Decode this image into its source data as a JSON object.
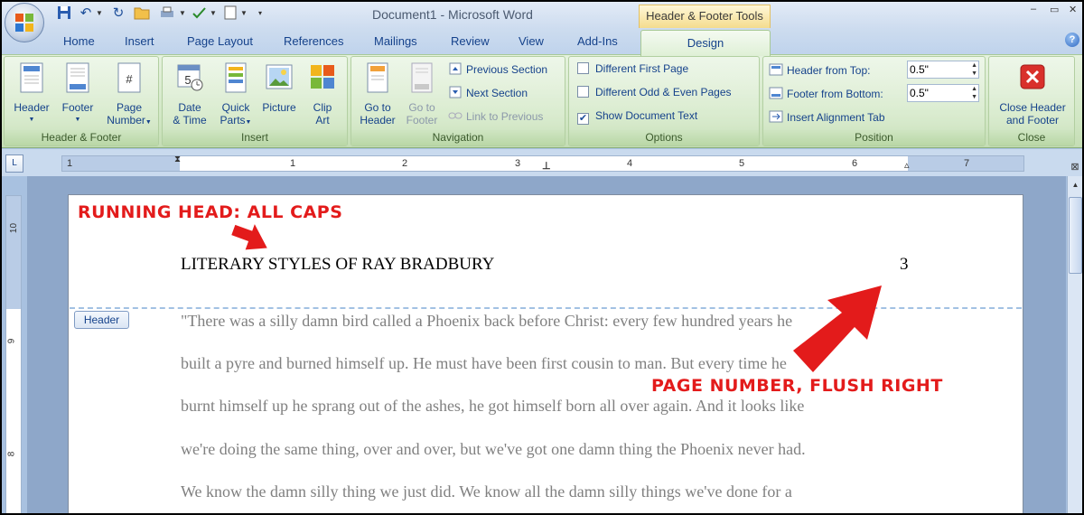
{
  "window": {
    "doc_title": "Document1 - Microsoft Word",
    "contextual_tab_title": "Header & Footer Tools",
    "controls": {
      "minimize": "–",
      "restore": "▭",
      "close": "✕"
    }
  },
  "quick_access": [
    "save-icon",
    "undo-icon",
    "redo-icon",
    "open-icon",
    "print-icon",
    "spelling-icon",
    "new-icon",
    "customize-icon"
  ],
  "tabs": [
    {
      "label": "Home"
    },
    {
      "label": "Insert"
    },
    {
      "label": "Page Layout"
    },
    {
      "label": "References"
    },
    {
      "label": "Mailings"
    },
    {
      "label": "Review"
    },
    {
      "label": "View"
    },
    {
      "label": "Add-Ins"
    },
    {
      "label": "Design",
      "active": true
    }
  ],
  "ribbon": {
    "header_footer": {
      "caption": "Header & Footer",
      "header": "Header",
      "footer": "Footer",
      "page_number_1": "Page",
      "page_number_2": "Number"
    },
    "insert": {
      "caption": "Insert",
      "date_1": "Date",
      "date_2": "& Time",
      "quick_1": "Quick",
      "quick_2": "Parts",
      "picture": "Picture",
      "clip_1": "Clip",
      "clip_2": "Art"
    },
    "navigation": {
      "caption": "Navigation",
      "goto_header_1": "Go to",
      "goto_header_2": "Header",
      "goto_footer_1": "Go to",
      "goto_footer_2": "Footer",
      "previous_section": "Previous Section",
      "next_section": "Next Section",
      "link_to_previous": "Link to Previous"
    },
    "options": {
      "caption": "Options",
      "different_first_page": "Different First Page",
      "different_first_page_checked": false,
      "different_odd_even": "Different Odd & Even Pages",
      "different_odd_even_checked": false,
      "show_document_text": "Show Document Text",
      "show_document_text_checked": true
    },
    "position": {
      "caption": "Position",
      "header_from_top_label": "Header from Top:",
      "header_from_top_value": "0.5\"",
      "footer_from_bottom_label": "Footer from Bottom:",
      "footer_from_bottom_value": "0.5\"",
      "insert_alignment_tab": "Insert Alignment Tab"
    },
    "close": {
      "caption": "Close",
      "close_1": "Close Header",
      "close_2": "and Footer"
    }
  },
  "ruler": {
    "corner": "L",
    "h_numbers": [
      "1",
      "1",
      "2",
      "3",
      "4",
      "5",
      "6",
      "7"
    ],
    "v_numbers": [
      "10",
      "9",
      "8"
    ]
  },
  "document": {
    "header_tag": "Header",
    "running_head": "LITERARY STYLES OF RAY BRADBURY",
    "page_number": "3",
    "body_lines": [
      "\"There was a silly damn bird called a Phoenix back before Christ: every few hundred years he",
      "built a pyre and burned himself up. He must have been first cousin to man. But every time he",
      "burnt himself up he sprang out of the ashes, he got himself born all over again. And it looks like",
      "we're doing the same thing, over and over, but we've got one damn thing the Phoenix never had.",
      "We know the damn silly thing we just did. We know all the damn silly things we've done for a"
    ]
  },
  "annotations": {
    "running_head_note": "RUNNING HEAD: ALL CAPS",
    "page_number_note": "PAGE NUMBER, FLUSH RIGHT"
  },
  "colors": {
    "annotation_red": "#e31b1b",
    "ribbon_green": "#d1e7c4",
    "accent_blue": "#15428b"
  }
}
